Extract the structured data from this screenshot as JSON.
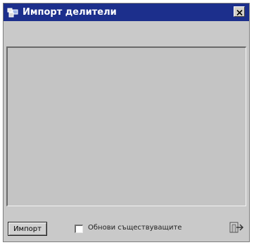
{
  "window": {
    "title": "Импорт делители"
  },
  "footer": {
    "import_label": "Импорт",
    "update_existing_label": "Обнови съществуващите",
    "update_existing_checked": false
  },
  "icons": {
    "app": "app-icon",
    "close": "close-icon",
    "exit": "exit-icon"
  },
  "colors": {
    "titlebar": "#1c2f8c",
    "window": "#c9c9c9",
    "panel": "#c4c4c4"
  }
}
